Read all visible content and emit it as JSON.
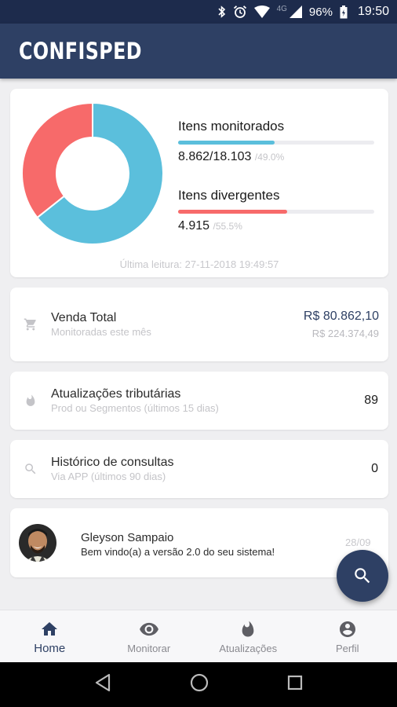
{
  "status_bar": {
    "network": "4G",
    "battery": "96%",
    "time": "19:50"
  },
  "app_bar": {
    "title": "CONFISPED"
  },
  "chart_data": {
    "type": "pie",
    "donut": true,
    "slices": [
      {
        "label": "Itens monitorados",
        "value": 8862,
        "color": "#5bbfdc"
      },
      {
        "label": "Itens divergentes",
        "value": 4915,
        "color": "#f76a6a"
      }
    ]
  },
  "summary": {
    "monitorados": {
      "label": "Itens monitorados",
      "value": "8.862",
      "total": "/18.103",
      "percent": "/49.0%",
      "fraction": 0.49,
      "color": "#5bbfdc"
    },
    "divergentes": {
      "label": "Itens divergentes",
      "value": "4.915",
      "percent": "/55.5%",
      "fraction": 0.555,
      "color": "#f76a6a"
    },
    "last_read": "Última leitura: 27-11-2018 19:49:57"
  },
  "venda": {
    "title": "Venda Total",
    "subtitle": "Monitoradas este mês",
    "value": "R$ 80.862,10",
    "total": "R$ 224.374,49",
    "icon": "cart-icon"
  },
  "atualizacoes": {
    "title": "Atualizações tributárias",
    "subtitle": "Prod ou Segmentos (últimos 15 dias)",
    "count": "89",
    "icon": "flame-icon"
  },
  "historico": {
    "title": "Histórico de consultas",
    "subtitle": "Via APP (últimos 90 dias)",
    "count": "0",
    "icon": "search-icon"
  },
  "message": {
    "name": "Gleyson Sampaio",
    "text": "Bem vindo(a) a versão 2.0 do seu sistema!",
    "date": "28/09"
  },
  "bottom_nav": [
    {
      "label": "Home",
      "icon": "home-icon",
      "active": true
    },
    {
      "label": "Monitorar",
      "icon": "eye-icon",
      "active": false
    },
    {
      "label": "Atualizações",
      "icon": "flame-icon",
      "active": false
    },
    {
      "label": "Perfil",
      "icon": "account-icon",
      "active": false
    }
  ],
  "colors": {
    "primary": "#2e4064",
    "status_bar": "#1d2b4c",
    "accent_blue": "#5bbfdc",
    "accent_red": "#f76a6a"
  }
}
